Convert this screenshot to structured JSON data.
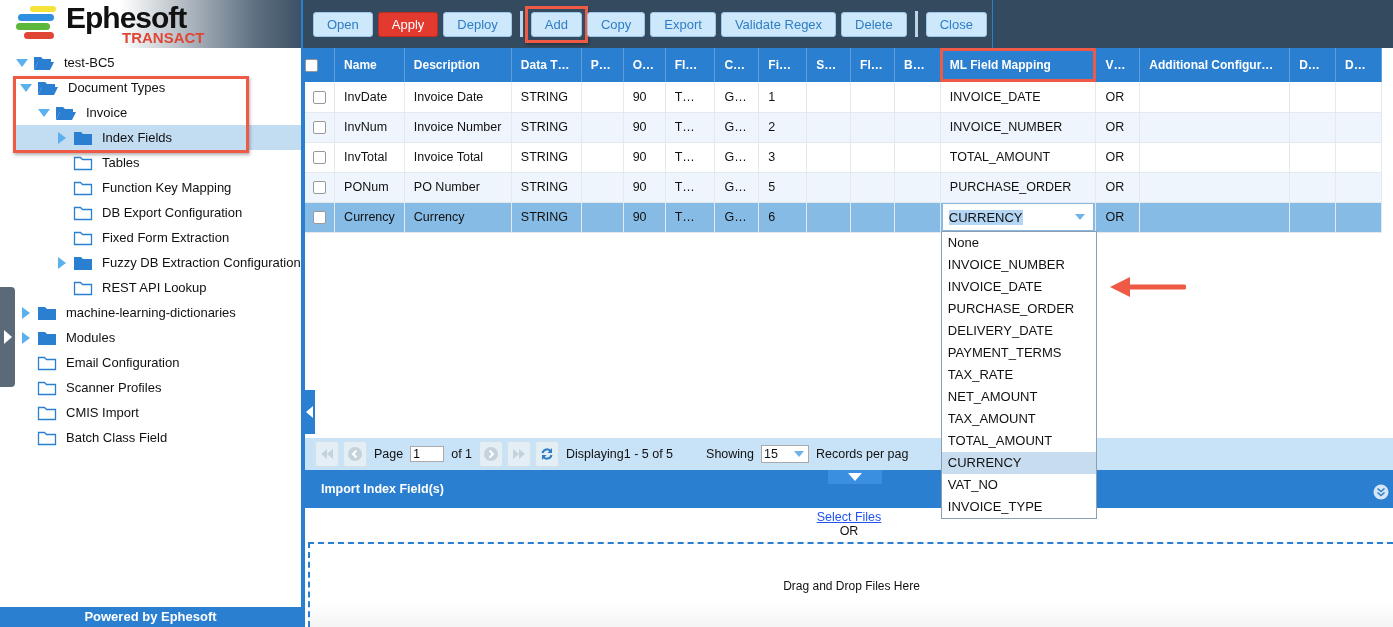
{
  "logo": {
    "name": "Ephesoft",
    "product": "TRANSACT"
  },
  "tree": [
    {
      "label": "test-BC5",
      "expanded": true,
      "selected": false,
      "children": [
        {
          "label": "Document Types",
          "expanded": true,
          "selected": false,
          "highlighted": true,
          "children": [
            {
              "label": "Invoice",
              "expanded": true,
              "selected": false,
              "children": [
                {
                  "label": "Index Fields",
                  "expanded": false,
                  "selected": true
                },
                {
                  "label": "Tables",
                  "selected": false
                },
                {
                  "label": "Function Key Mapping",
                  "selected": false
                },
                {
                  "label": "DB Export Configuration",
                  "selected": false
                },
                {
                  "label": "Fixed Form Extraction",
                  "selected": false
                },
                {
                  "label": "Fuzzy DB Extraction Configuration",
                  "expanded": false,
                  "selected": false
                },
                {
                  "label": "REST API Lookup",
                  "selected": false
                }
              ]
            }
          ]
        },
        {
          "label": "machine-learning-dictionaries",
          "expanded": false,
          "selected": false
        },
        {
          "label": "Modules",
          "expanded": false,
          "selected": false
        },
        {
          "label": "Email Configuration",
          "selected": false
        },
        {
          "label": "Scanner Profiles",
          "selected": false
        },
        {
          "label": "CMIS Import",
          "selected": false
        },
        {
          "label": "Batch Class Field",
          "selected": false
        }
      ]
    }
  ],
  "footer": "Powered by Ephesoft",
  "toolbar": [
    [
      {
        "label": "Open",
        "kind": "default",
        "highlighted": false
      },
      {
        "label": "Apply",
        "kind": "primary",
        "highlighted": false
      },
      {
        "label": "Deploy",
        "kind": "default",
        "highlighted": false
      }
    ],
    [
      {
        "label": "Add",
        "kind": "default",
        "highlighted": true
      },
      {
        "label": "Copy",
        "kind": "default",
        "highlighted": false
      },
      {
        "label": "Export",
        "kind": "default",
        "highlighted": false
      },
      {
        "label": "Validate Regex",
        "kind": "default",
        "highlighted": false
      },
      {
        "label": "Delete",
        "kind": "default",
        "highlighted": false
      }
    ],
    [
      {
        "label": "Close",
        "kind": "default",
        "highlighted": false
      }
    ]
  ],
  "table": {
    "select_all_checked": false,
    "columns": [
      {
        "label": "Name",
        "highlighted": false
      },
      {
        "label": "Description",
        "highlighted": false
      },
      {
        "label": "Data T…",
        "highlighted": false
      },
      {
        "label": "P…",
        "highlighted": false
      },
      {
        "label": "O…",
        "highlighted": false
      },
      {
        "label": "Fl…",
        "highlighted": false
      },
      {
        "label": "C…",
        "highlighted": false
      },
      {
        "label": "Fi…",
        "highlighted": false
      },
      {
        "label": "S…",
        "highlighted": false
      },
      {
        "label": "Fl…",
        "highlighted": false
      },
      {
        "label": "B…",
        "highlighted": false
      },
      {
        "label": "ML Field Mapping",
        "highlighted": true,
        "editor": true
      },
      {
        "label": "V…",
        "highlighted": false
      },
      {
        "label": "Additional Configur…",
        "highlighted": false
      },
      {
        "label": "D…",
        "highlighted": false
      },
      {
        "label": "D…",
        "highlighted": false
      }
    ],
    "rows": [
      {
        "checked": false,
        "selected": false,
        "editing": false,
        "cells": [
          "InvDate",
          "Invoice Date",
          "STRING",
          null,
          "90",
          "T…",
          "G…",
          "1",
          null,
          null,
          null,
          "INVOICE_DATE",
          "OR",
          null,
          null,
          null
        ]
      },
      {
        "checked": false,
        "selected": false,
        "editing": false,
        "cells": [
          "InvNum",
          "Invoice Number",
          "STRING",
          null,
          "90",
          "T…",
          "G…",
          "2",
          null,
          null,
          null,
          "INVOICE_NUMBER",
          "OR",
          null,
          null,
          null
        ]
      },
      {
        "checked": false,
        "selected": false,
        "editing": false,
        "cells": [
          "InvTotal",
          "Invoice Total",
          "STRING",
          null,
          "90",
          "T…",
          "G…",
          "3",
          null,
          null,
          null,
          "TOTAL_AMOUNT",
          "OR",
          null,
          null,
          null
        ]
      },
      {
        "checked": false,
        "selected": false,
        "editing": false,
        "cells": [
          "PONum",
          "PO Number",
          "STRING",
          null,
          "90",
          "T…",
          "G…",
          "5",
          null,
          null,
          null,
          "PURCHASE_ORDER",
          "OR",
          null,
          null,
          null
        ]
      },
      {
        "checked": false,
        "selected": true,
        "editing": true,
        "cells": [
          "Currency",
          "Currency",
          "STRING",
          null,
          "90",
          "T…",
          "G…",
          "6",
          null,
          null,
          null,
          "CURRENCY",
          "OR",
          null,
          null,
          null
        ]
      }
    ],
    "dropdown_options": [
      {
        "label": "None",
        "selected": false
      },
      {
        "label": "INVOICE_NUMBER",
        "selected": false
      },
      {
        "label": "INVOICE_DATE",
        "selected": false
      },
      {
        "label": "PURCHASE_ORDER",
        "selected": false
      },
      {
        "label": "DELIVERY_DATE",
        "selected": false
      },
      {
        "label": "PAYMENT_TERMS",
        "selected": false
      },
      {
        "label": "TAX_RATE",
        "selected": false
      },
      {
        "label": "NET_AMOUNT",
        "selected": false
      },
      {
        "label": "TAX_AMOUNT",
        "selected": false
      },
      {
        "label": "TOTAL_AMOUNT",
        "selected": false
      },
      {
        "label": "CURRENCY",
        "selected": true
      },
      {
        "label": "VAT_NO",
        "selected": false
      },
      {
        "label": "INVOICE_TYPE",
        "selected": false
      }
    ]
  },
  "pager": {
    "page_label": "Page",
    "page": "1",
    "of": "of 1",
    "displaying": "Displaying1 - 5 of 5",
    "showing": "Showing",
    "per_page": "15",
    "records": "Records per pag"
  },
  "import": {
    "title": "Import Index Field(s)",
    "link": "Select Files",
    "or": "OR",
    "drop": "Drag and Drop Files Here"
  }
}
